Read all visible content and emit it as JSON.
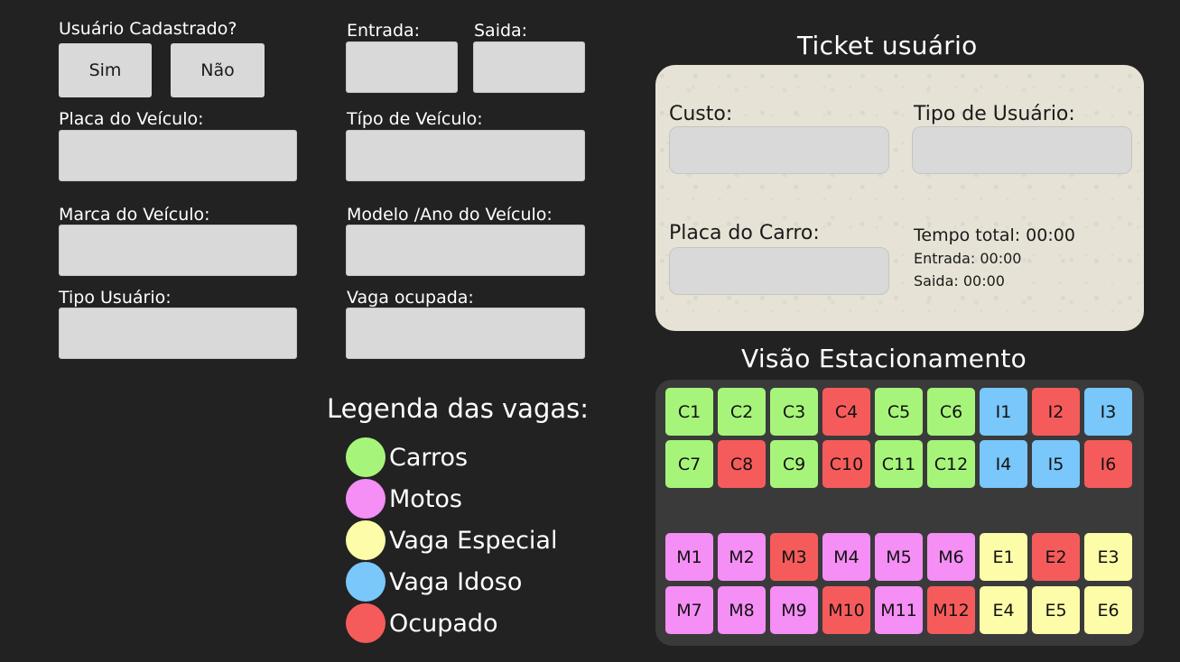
{
  "form": {
    "registered_label": "Usuário Cadastrado?",
    "yes_button": "Sim",
    "no_button": "Não",
    "entry_label": "Entrada:",
    "exit_label": "Saida:",
    "plate_label": "Placa do Veículo:",
    "vehicle_type_label": "Típo de Veículo:",
    "brand_label": "Marca do Veículo:",
    "model_label": "Modelo /Ano do Veículo:",
    "user_type_label": "Tipo Usuário:",
    "spot_label": "Vaga ocupada:"
  },
  "ticket": {
    "title": "Ticket usuário",
    "cost_label": "Custo:",
    "user_type_label": "Tipo de Usuário:",
    "plate_label": "Placa do Carro:",
    "total_time": "Tempo total: 00:00",
    "entry_time": "Entrada: 00:00",
    "exit_time": "Saida: 00:00"
  },
  "legend": {
    "title": "Legenda das vagas:",
    "items": [
      {
        "label": "Carros",
        "color": "#a6f57a"
      },
      {
        "label": "Motos",
        "color": "#f58ef5"
      },
      {
        "label": "Vaga Especial",
        "color": "#fdfca9"
      },
      {
        "label": "Vaga Idoso",
        "color": "#79c7fb"
      },
      {
        "label": "Ocupado",
        "color": "#f65b5b"
      }
    ]
  },
  "parking": {
    "title": "Visão Estacionamento",
    "colors": {
      "car": "#a6f57a",
      "moto": "#f58ef5",
      "special": "#fdfca9",
      "elderly": "#79c7fb",
      "occupied": "#f65b5b"
    },
    "rows": [
      [
        {
          "id": "C1",
          "status": "car"
        },
        {
          "id": "C2",
          "status": "car"
        },
        {
          "id": "C3",
          "status": "car"
        },
        {
          "id": "C4",
          "status": "occupied"
        },
        {
          "id": "C5",
          "status": "car"
        },
        {
          "id": "C6",
          "status": "car"
        },
        {
          "id": "I1",
          "status": "elderly"
        },
        {
          "id": "I2",
          "status": "occupied"
        },
        {
          "id": "I3",
          "status": "elderly"
        }
      ],
      [
        {
          "id": "C7",
          "status": "car"
        },
        {
          "id": "C8",
          "status": "occupied"
        },
        {
          "id": "C9",
          "status": "car"
        },
        {
          "id": "C10",
          "status": "occupied"
        },
        {
          "id": "C11",
          "status": "car"
        },
        {
          "id": "C12",
          "status": "car"
        },
        {
          "id": "I4",
          "status": "elderly"
        },
        {
          "id": "I5",
          "status": "elderly"
        },
        {
          "id": "I6",
          "status": "occupied"
        }
      ],
      [
        {
          "id": "M1",
          "status": "moto"
        },
        {
          "id": "M2",
          "status": "moto"
        },
        {
          "id": "M3",
          "status": "occupied"
        },
        {
          "id": "M4",
          "status": "moto"
        },
        {
          "id": "M5",
          "status": "moto"
        },
        {
          "id": "M6",
          "status": "moto"
        },
        {
          "id": "E1",
          "status": "special"
        },
        {
          "id": "E2",
          "status": "occupied"
        },
        {
          "id": "E3",
          "status": "special"
        }
      ],
      [
        {
          "id": "M7",
          "status": "moto"
        },
        {
          "id": "M8",
          "status": "moto"
        },
        {
          "id": "M9",
          "status": "moto"
        },
        {
          "id": "M10",
          "status": "occupied"
        },
        {
          "id": "M11",
          "status": "moto"
        },
        {
          "id": "M12",
          "status": "occupied"
        },
        {
          "id": "E4",
          "status": "special"
        },
        {
          "id": "E5",
          "status": "special"
        },
        {
          "id": "E6",
          "status": "special"
        }
      ]
    ]
  }
}
